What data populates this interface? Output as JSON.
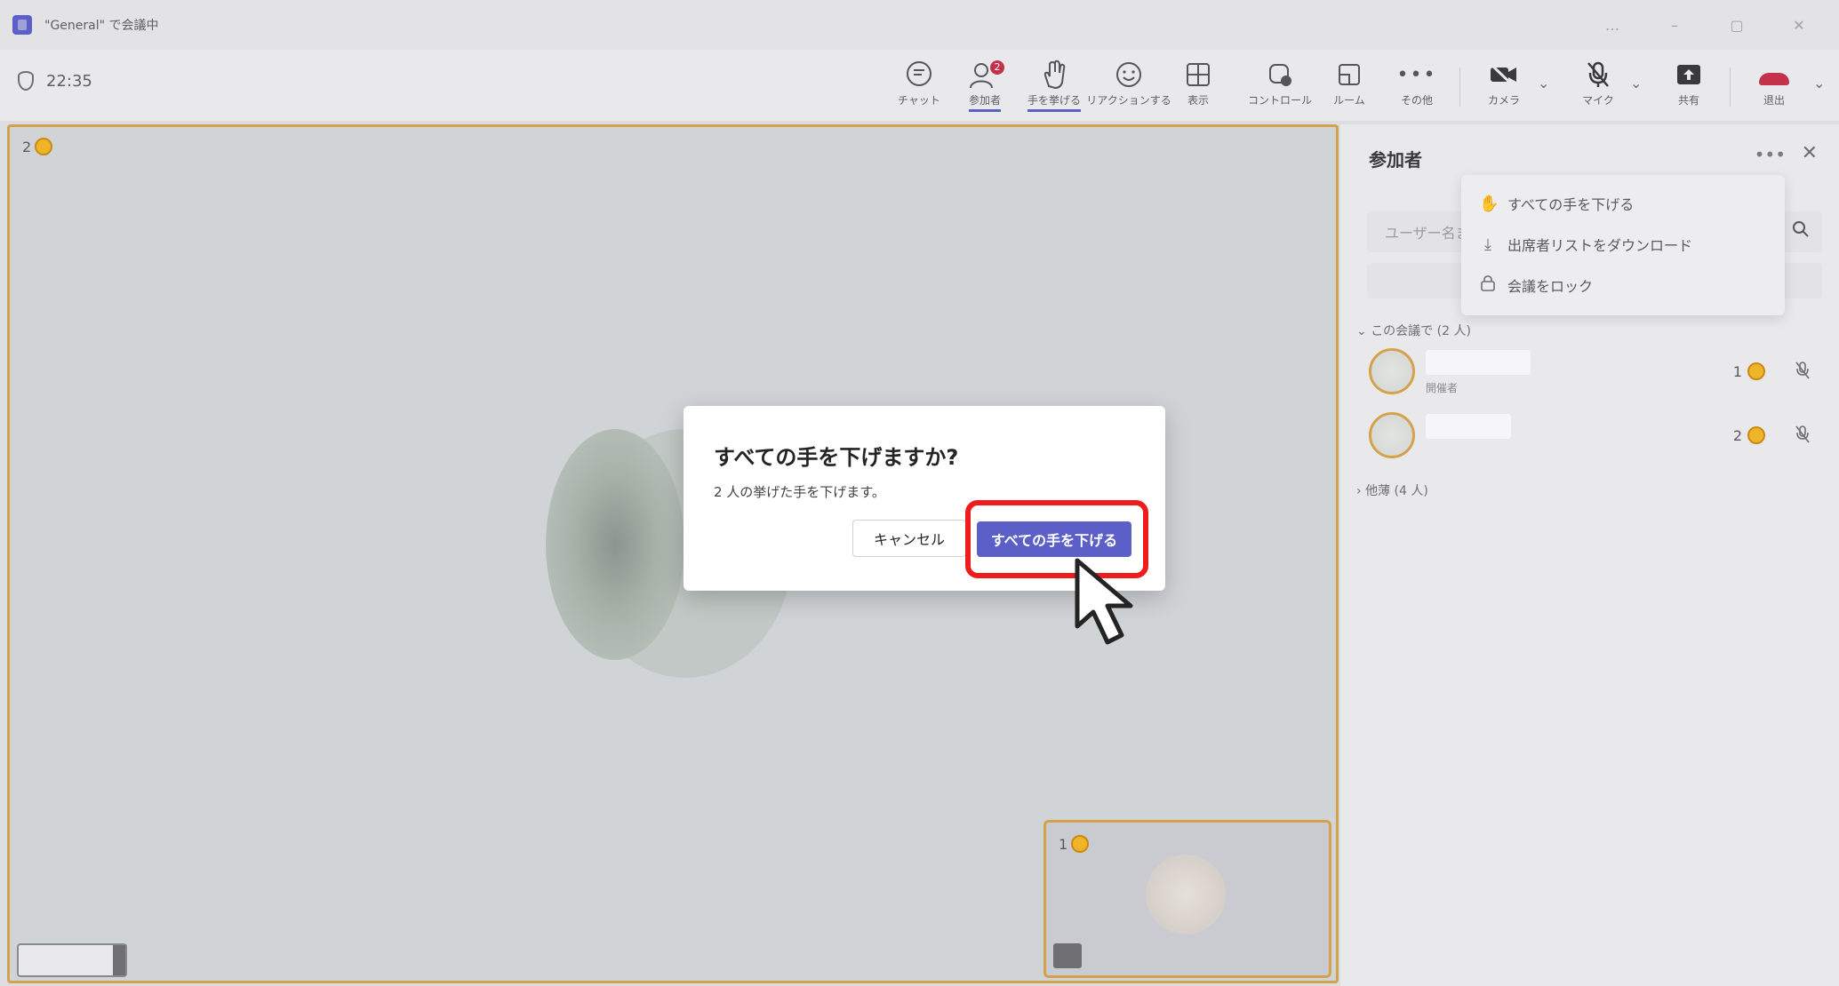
{
  "window": {
    "title": "\"General\" で会議中",
    "controls": [
      "…",
      "–",
      "▢",
      "✕"
    ]
  },
  "toolbar": {
    "timer": "22:35",
    "buttons": [
      {
        "id": "chat",
        "label": "チャット",
        "icon": "chat-icon"
      },
      {
        "id": "participants",
        "label": "参加者",
        "icon": "people-icon",
        "badge": "2"
      },
      {
        "id": "raise-hand",
        "label": "手を挙げる",
        "icon": "hand-icon"
      },
      {
        "id": "react",
        "label": "リアクションする",
        "icon": "smile-icon"
      },
      {
        "id": "view",
        "label": "表示",
        "icon": "grid-icon"
      },
      {
        "id": "control",
        "label": "コントロール",
        "icon": "control-icon"
      },
      {
        "id": "rooms",
        "label": "ルーム",
        "icon": "rooms-icon"
      },
      {
        "id": "more",
        "label": "その他",
        "icon": "more-icon"
      },
      {
        "id": "camera",
        "label": "カメラ",
        "icon": "camera-off-icon"
      },
      {
        "id": "mic",
        "label": "マイク",
        "icon": "mic-off-icon"
      },
      {
        "id": "share",
        "label": "共有",
        "icon": "share-icon"
      },
      {
        "id": "leave",
        "label": "退出",
        "icon": "hangup-icon"
      }
    ]
  },
  "stage": {
    "main_hand_count": "2",
    "mini_hand_count": "1"
  },
  "panel": {
    "title": "参加者",
    "search_placeholder": "ユーザー名ま",
    "section_in_meeting": "この会議で (2 人)",
    "section_others": "他薄 (4 人)",
    "participants": [
      {
        "role": "開催者",
        "hand": "1"
      },
      {
        "role": "",
        "hand": "2"
      }
    ]
  },
  "menu": {
    "items": [
      {
        "label": "すべての手を下げる",
        "icon": "hand-down-icon"
      },
      {
        "label": "出席者リストをダウンロード",
        "icon": "download-icon"
      },
      {
        "label": "会議をロック",
        "icon": "lock-icon"
      }
    ]
  },
  "dialog": {
    "title": "すべての手を下げますか?",
    "message": "2 人の挙げた手を下げます。",
    "cancel_label": "キャンセル",
    "confirm_label": "すべての手を下げる"
  },
  "colors": {
    "accent": "#5b5fc7",
    "highlight": "#ee1c1c",
    "spotlight_border": "#d4a24c",
    "hand": "#f0b429",
    "danger": "#c4314b"
  }
}
